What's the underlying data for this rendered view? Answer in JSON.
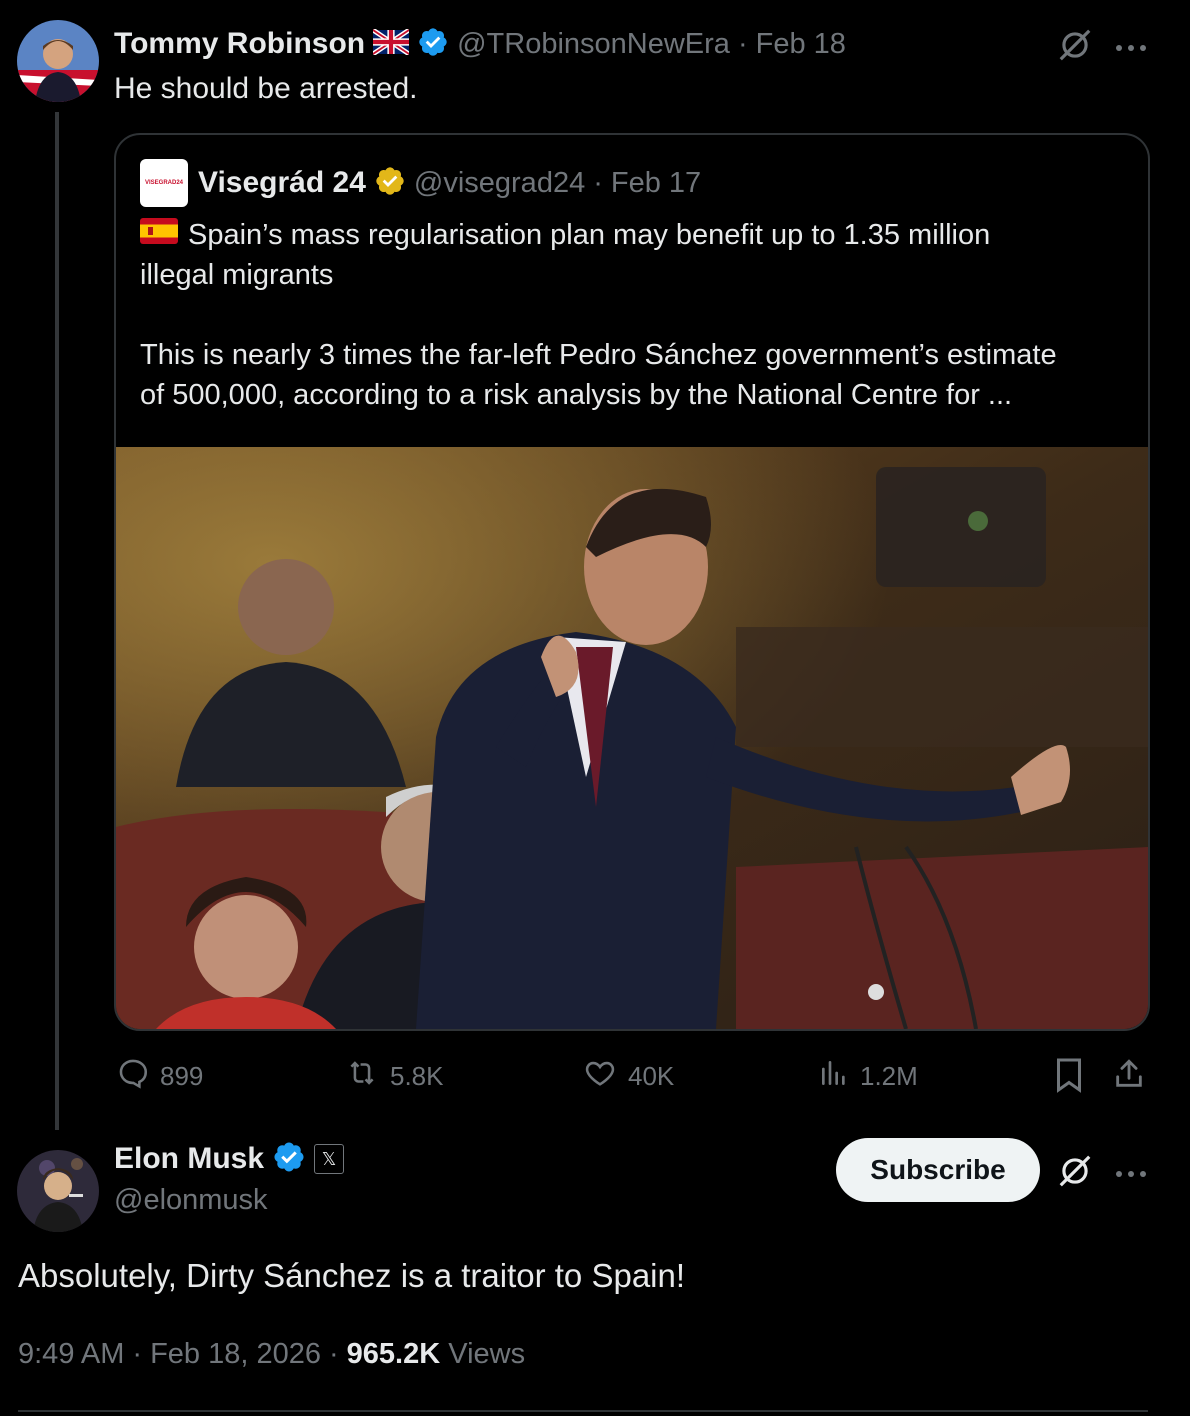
{
  "tweet1": {
    "display_name": "Tommy Robinson",
    "handle": "@TRobinsonNewEra",
    "separator": "·",
    "date": "Feb 18",
    "text": "He should be arrested."
  },
  "quoted": {
    "avatar_text": "VISEGRAD24",
    "display_name": "Visegrád 24",
    "handle": "@visegrad24",
    "separator": "·",
    "date": "Feb 17",
    "text_line1": "Spain’s mass regularisation plan may benefit up to 1.35 million",
    "text_line2": "illegal migrants",
    "text_line3": "This is nearly 3 times the far-left Pedro Sánchez government’s estimate",
    "text_line4": "of 500,000, according to a risk analysis by the National Centre for ..."
  },
  "actions": {
    "replies": "899",
    "reposts": "5.8K",
    "likes": "40K",
    "views": "1.2M"
  },
  "tweet2": {
    "display_name": "Elon Musk",
    "x_badge": "𝕏",
    "handle": "@elonmusk",
    "subscribe_label": "Subscribe",
    "text": "Absolutely, Dirty Sánchez is a traitor to Spain!",
    "time": "9:49 AM",
    "separator1": "·",
    "date": "Feb 18, 2026",
    "separator2": "·",
    "views_count": "965.2K",
    "views_label": "Views"
  },
  "colors": {
    "verified_blue": "#1d9bf0",
    "verified_gold": "#e2b719",
    "muted": "#71767b",
    "text": "#e7e9ea"
  },
  "icons": [
    "uk-flag-icon",
    "verified-badge-icon",
    "grok-icon",
    "more-icon",
    "spain-flag-icon",
    "reply-icon",
    "repost-icon",
    "like-icon",
    "views-icon",
    "bookmark-icon",
    "share-icon",
    "x-badge-icon"
  ]
}
